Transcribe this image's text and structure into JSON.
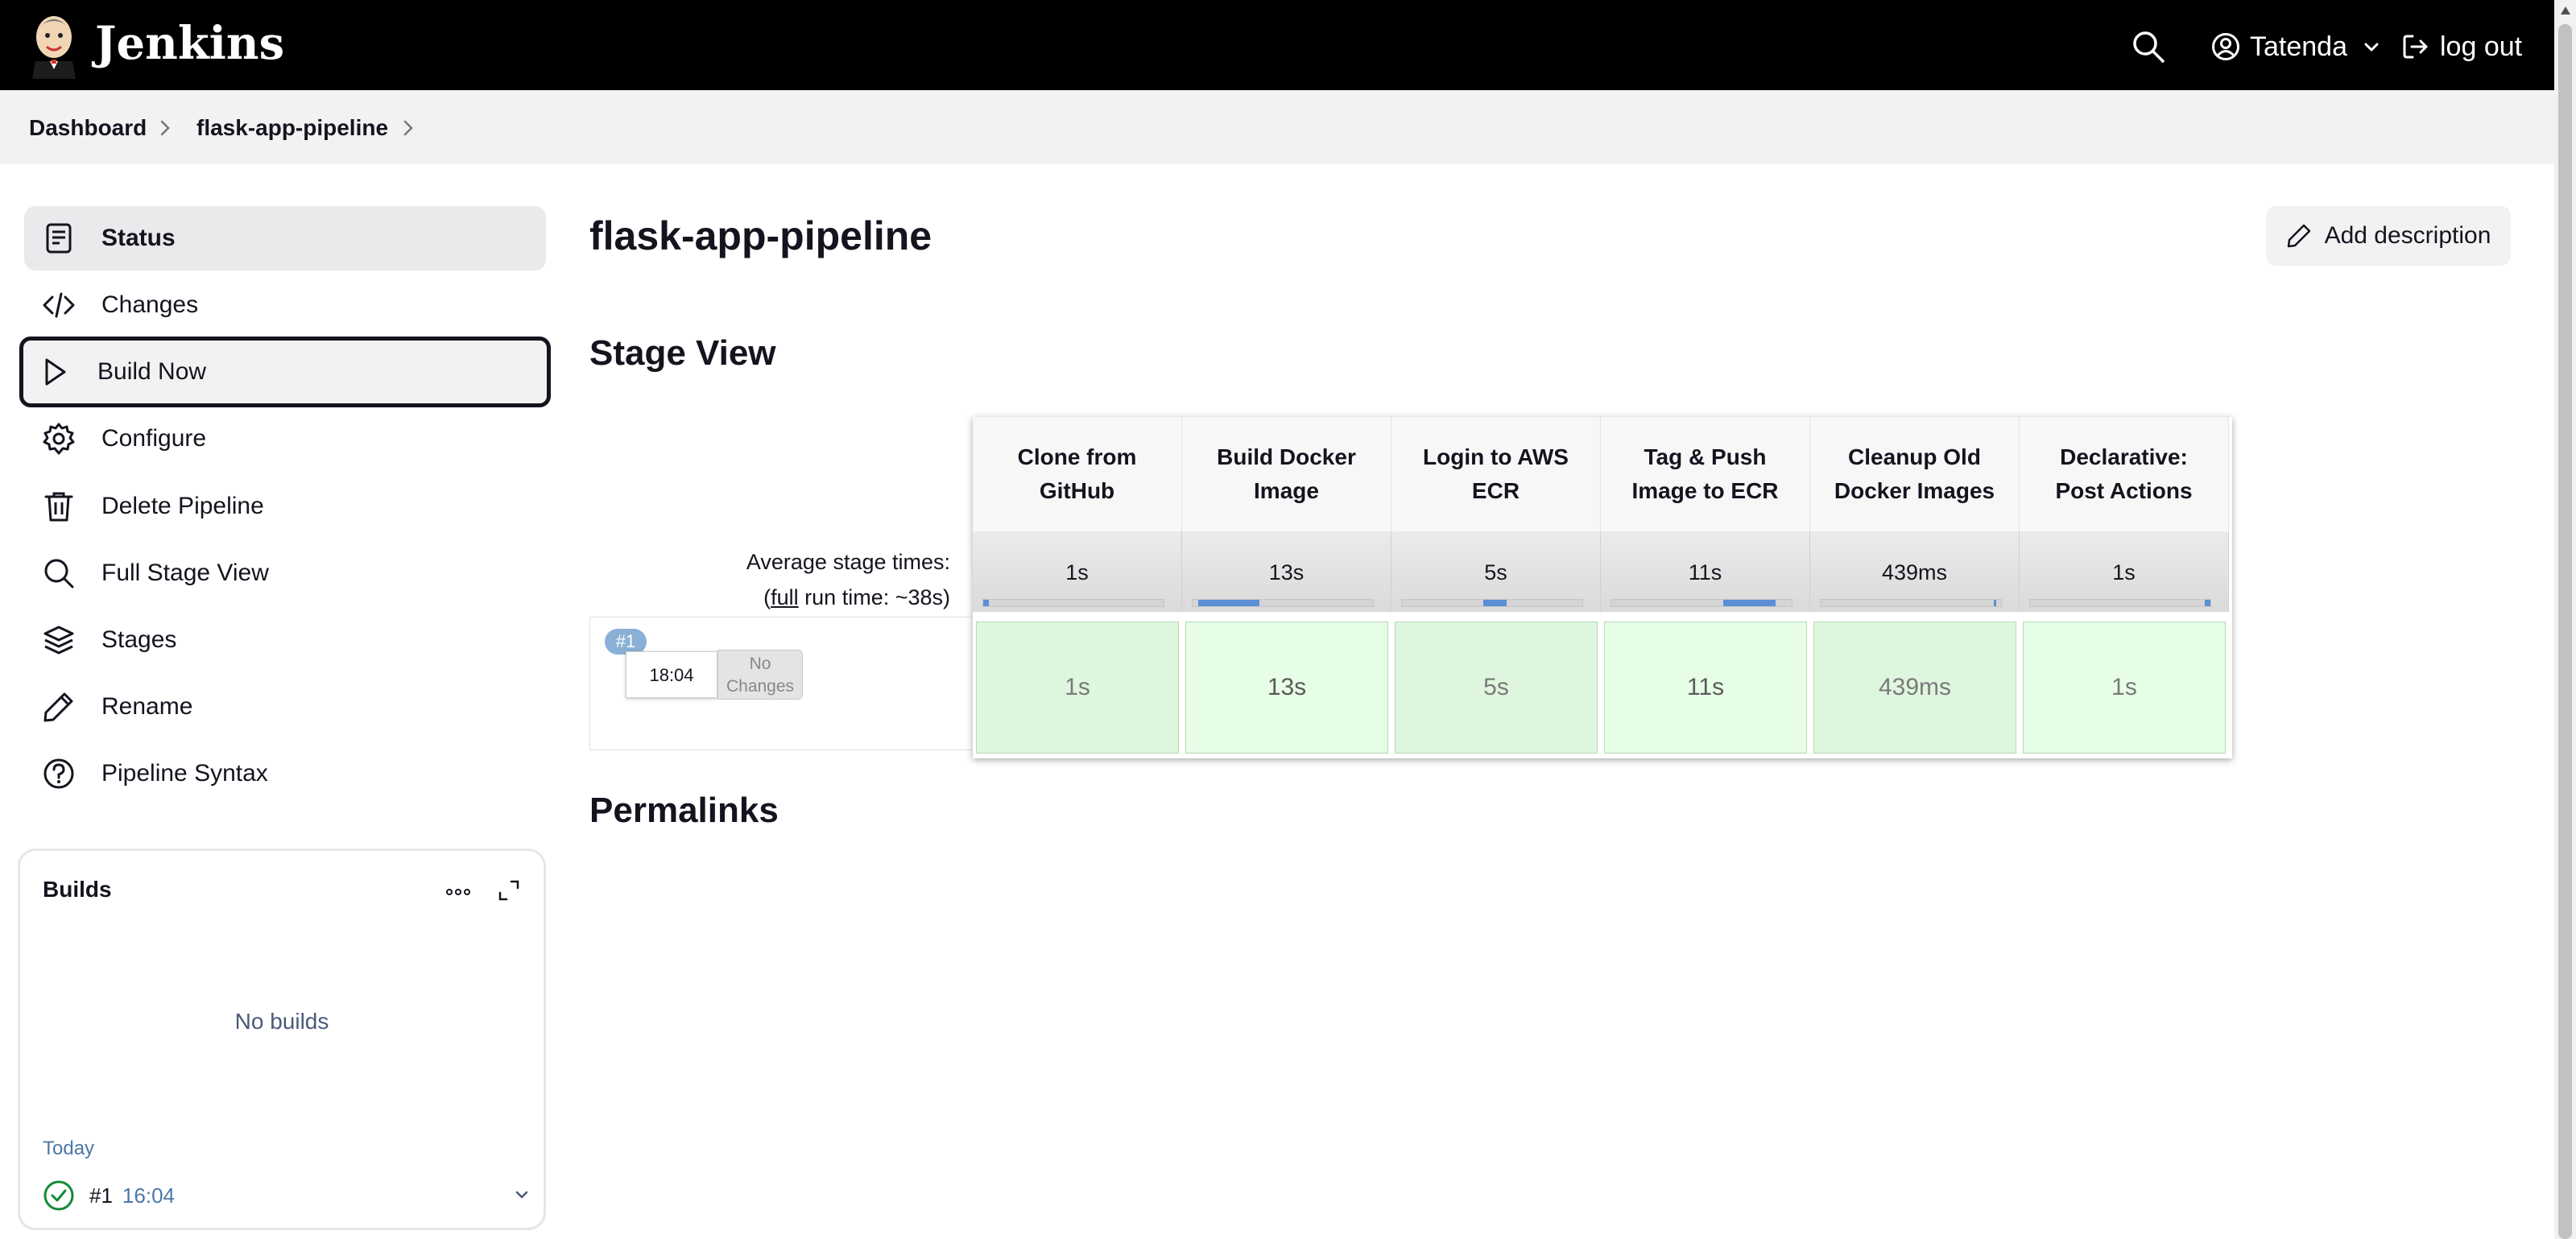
{
  "header": {
    "brand": "Jenkins",
    "user_name": "Tatenda",
    "logout_label": "log out"
  },
  "breadcrumb": [
    "Dashboard",
    "flask-app-pipeline"
  ],
  "sidebar": {
    "items": [
      {
        "label": "Status",
        "icon": "status-icon"
      },
      {
        "label": "Changes",
        "icon": "code-icon"
      },
      {
        "label": "Build Now",
        "icon": "play-icon"
      },
      {
        "label": "Configure",
        "icon": "gear-icon"
      },
      {
        "label": "Delete Pipeline",
        "icon": "trash-icon"
      },
      {
        "label": "Full Stage View",
        "icon": "search-icon"
      },
      {
        "label": "Stages",
        "icon": "layers-icon"
      },
      {
        "label": "Rename",
        "icon": "pencil-icon"
      },
      {
        "label": "Pipeline Syntax",
        "icon": "help-icon"
      }
    ]
  },
  "builds": {
    "title": "Builds",
    "empty_text": "No builds",
    "group_label": "Today",
    "rows": [
      {
        "number": "#1",
        "time": "16:04",
        "status": "success"
      }
    ]
  },
  "main": {
    "title": "flask-app-pipeline",
    "add_description_label": "Add description",
    "stage_view_heading": "Stage View",
    "permalinks_heading": "Permalinks"
  },
  "stage_view": {
    "avg_label_line1": "Average stage times:",
    "avg_label_open": "(",
    "avg_label_link": "full",
    "avg_label_rest": " run time: ~38s)",
    "stages": [
      {
        "name_line1": "Clone from",
        "name_line2": "GitHub",
        "avg": "1s",
        "run": "1s",
        "bar_start": 0.0,
        "bar_fraction": 0.03
      },
      {
        "name_line1": "Build Docker",
        "name_line2": "Image",
        "avg": "13s",
        "run": "13s",
        "bar_start": 0.03,
        "bar_fraction": 0.34
      },
      {
        "name_line1": "Login to AWS",
        "name_line2": "ECR",
        "avg": "5s",
        "run": "5s",
        "bar_start": 0.45,
        "bar_fraction": 0.13
      },
      {
        "name_line1": "Tag & Push",
        "name_line2": "Image to ECR",
        "avg": "11s",
        "run": "11s",
        "bar_start": 0.62,
        "bar_fraction": 0.29
      },
      {
        "name_line1": "Cleanup Old",
        "name_line2": "Docker Images",
        "avg": "439ms",
        "run": "439ms",
        "bar_start": 0.96,
        "bar_fraction": 0.012
      },
      {
        "name_line1": "Declarative:",
        "name_line2": "Post Actions",
        "avg": "1s",
        "run": "1s",
        "bar_start": 0.97,
        "bar_fraction": 0.03
      }
    ],
    "run": {
      "badge": "#1",
      "time": "18:04",
      "changes_line1": "No",
      "changes_line2": "Changes"
    }
  },
  "colors": {
    "header_bg": "#000000",
    "success": "#138a36",
    "stage_bar": "#5b8fd6",
    "cell_green_a": "#def6de",
    "cell_green_b": "#e6fde6",
    "link_blue": "#4a78a8"
  }
}
